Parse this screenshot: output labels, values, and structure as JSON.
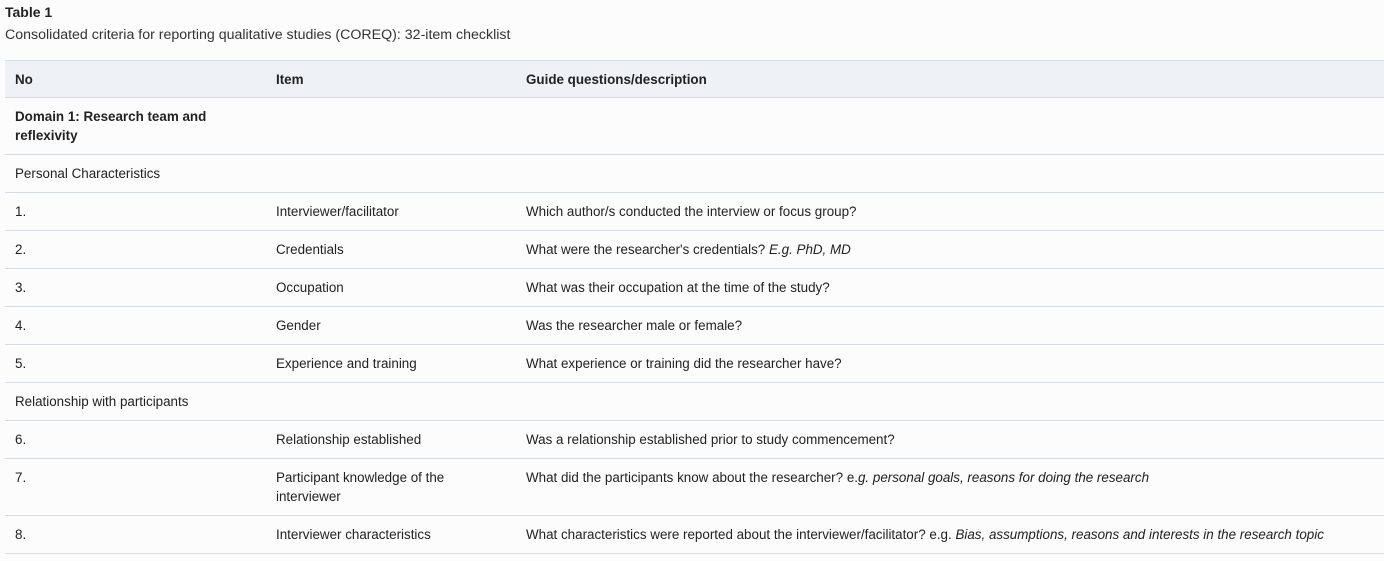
{
  "title": "Table 1",
  "caption": "Consolidated criteria for reporting qualitative studies (COREQ): 32-item checklist",
  "headers": [
    "No",
    "Item",
    "Guide questions/description"
  ],
  "rows": [
    {
      "type": "domain",
      "label": "Domain 1: Research team and reflexivity"
    },
    {
      "type": "section",
      "label": "Personal Characteristics"
    },
    {
      "type": "item",
      "no": "1.",
      "item": "Interviewer/facilitator",
      "desc": "Which author/s conducted the interview or focus group?",
      "desc_italic": ""
    },
    {
      "type": "item",
      "no": "2.",
      "item": "Credentials",
      "desc": "What were the researcher's credentials? ",
      "desc_italic": "E.g. PhD, MD"
    },
    {
      "type": "item",
      "no": "3.",
      "item": "Occupation",
      "desc": "What was their occupation at the time of the study?",
      "desc_italic": ""
    },
    {
      "type": "item",
      "no": "4.",
      "item": "Gender",
      "desc": "Was the researcher male or female?",
      "desc_italic": ""
    },
    {
      "type": "item",
      "no": "5.",
      "item": "Experience and training",
      "desc": "What experience or training did the researcher have?",
      "desc_italic": ""
    },
    {
      "type": "section",
      "label": "Relationship with participants"
    },
    {
      "type": "item",
      "no": "6.",
      "item": "Relationship established",
      "desc": "Was a relationship established prior to study commencement?",
      "desc_italic": ""
    },
    {
      "type": "item",
      "no": "7.",
      "item": "Participant knowledge of the interviewer",
      "desc": "What did the participants know about the researcher? e.",
      "desc_italic": "g. personal goals, reasons for doing the research"
    },
    {
      "type": "item",
      "no": "8.",
      "item": "Interviewer characteristics",
      "desc": "What characteristics were reported about the interviewer/facilitator? e.g. ",
      "desc_italic": "Bias, assumptions, reasons and interests in the research topic"
    }
  ]
}
